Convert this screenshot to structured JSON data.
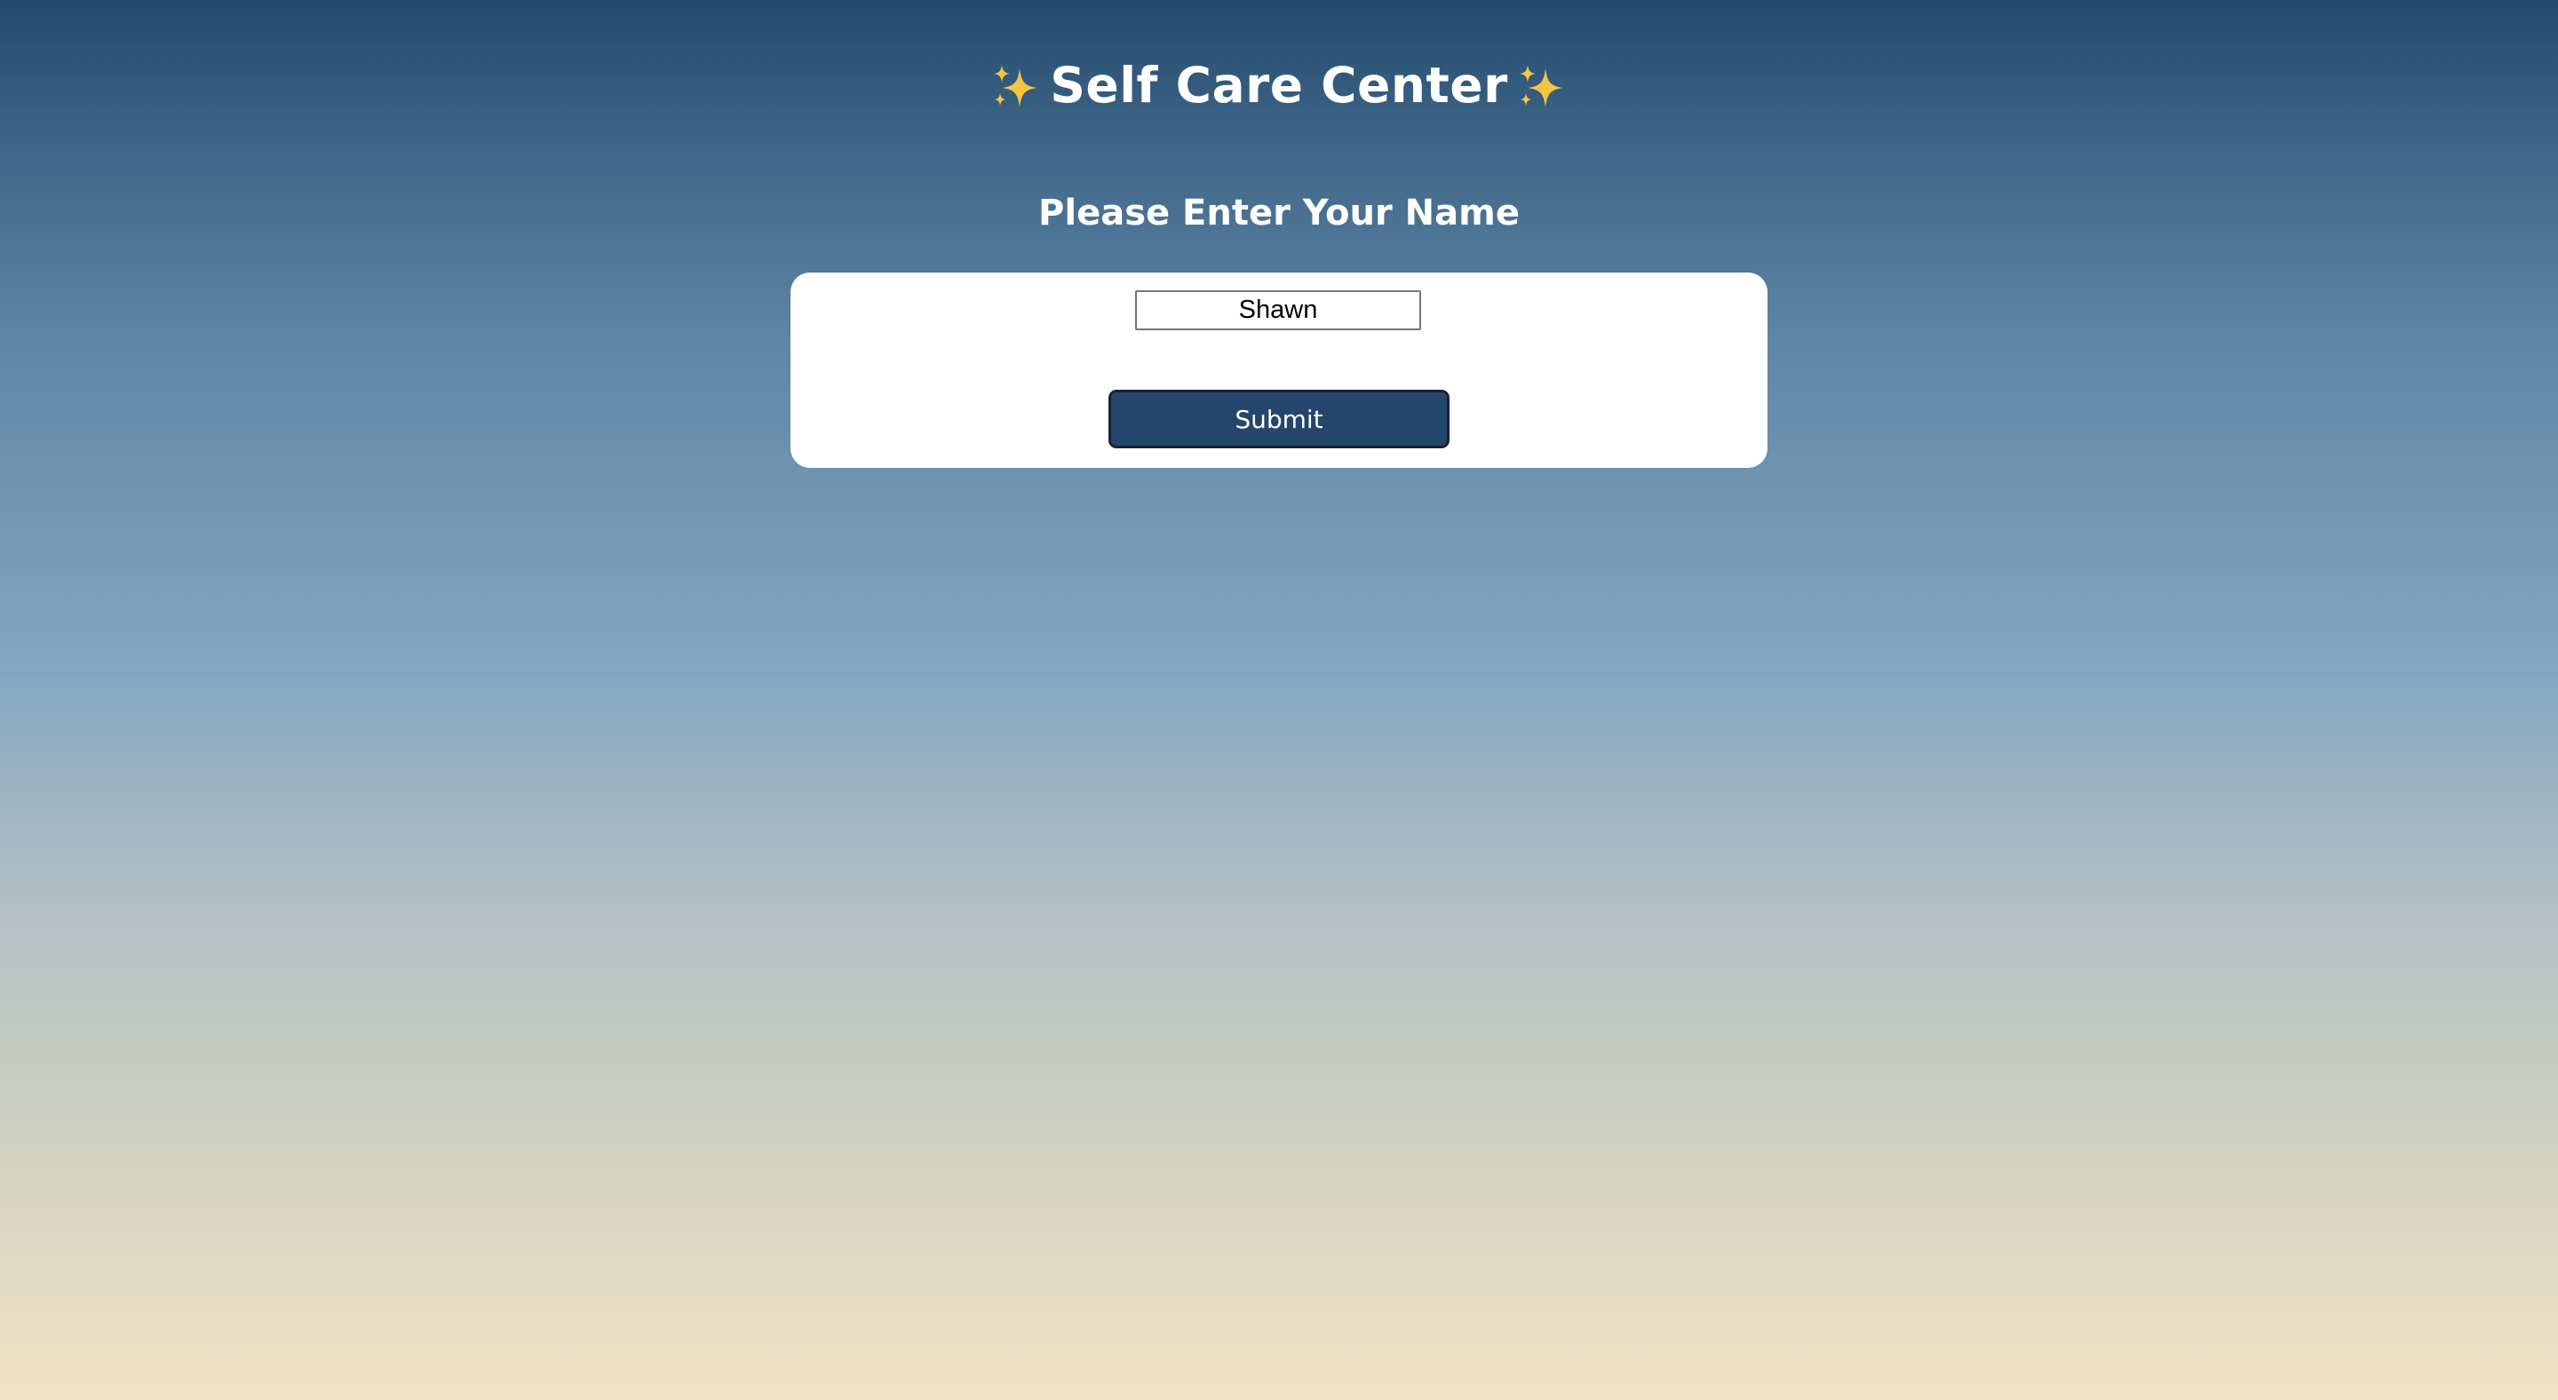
{
  "header": {
    "title": "Self Care Center",
    "left_icon": "sparkles-icon",
    "right_icon": "sparkles-icon"
  },
  "form": {
    "prompt": "Please Enter Your Name",
    "name_value": "Shawn",
    "submit_label": "Submit"
  },
  "colors": {
    "gradient_top": "#234b6e",
    "gradient_bottom": "#f2e3c5",
    "button": "#24466c",
    "sparkle": "#f5c542"
  }
}
